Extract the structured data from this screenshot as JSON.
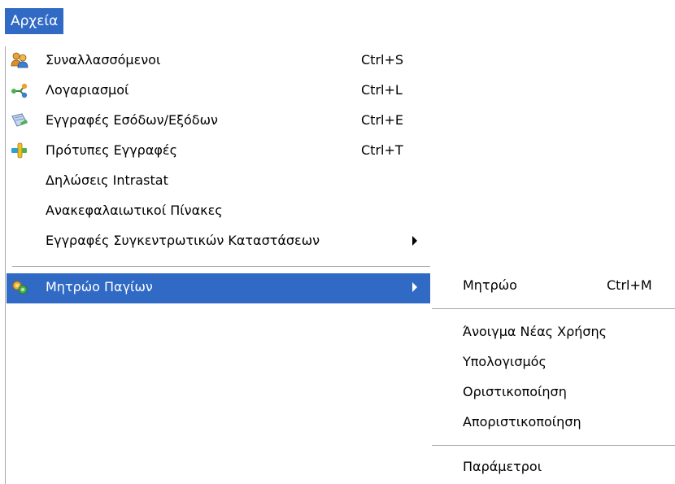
{
  "menubar": {
    "active_menu_label": "Αρχεία"
  },
  "main_menu": {
    "items": [
      {
        "label": "Συναλλασσόμενοι",
        "shortcut": "Ctrl+S",
        "icon": "people-icon"
      },
      {
        "label": "Λογαριασμοί",
        "shortcut": "Ctrl+L",
        "icon": "accounts-icon"
      },
      {
        "label": "Εγγραφές Εσόδων/Εξόδων",
        "shortcut": "Ctrl+E",
        "icon": "income-expense-icon"
      },
      {
        "label": "Πρότυπες Εγγραφές",
        "shortcut": "Ctrl+T",
        "icon": "template-entries-icon"
      },
      {
        "label": "Δηλώσεις Intrastat"
      },
      {
        "label": "Ανακεφαλαιωτικοί Πίνακες"
      },
      {
        "label": "Εγγραφές Συγκεντρωτικών Καταστάσεων",
        "has_submenu": true
      },
      {
        "label": "Μητρώο Παγίων",
        "has_submenu": true,
        "highlighted": true,
        "icon": "fixed-assets-gear-icon"
      }
    ]
  },
  "submenu": {
    "items": [
      {
        "label": "Μητρώο",
        "shortcut": "Ctrl+M"
      },
      {
        "label": "Άνοιγμα Νέας Χρήσης"
      },
      {
        "label": "Υπολογισμός"
      },
      {
        "label": "Οριστικοποίηση"
      },
      {
        "label": "Αποριστικοποίηση"
      },
      {
        "label": "Παράμετροι"
      }
    ]
  },
  "colors": {
    "highlight": "#316ac5",
    "highlight_text": "#ffffff",
    "separator": "#a7a6aa"
  }
}
